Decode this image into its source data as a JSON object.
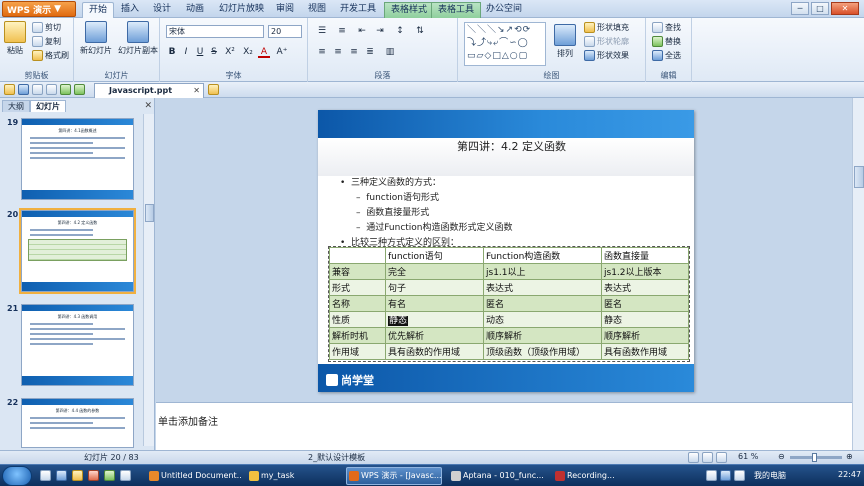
{
  "app": {
    "name": "WPS 演示",
    "dropdown": "▼"
  },
  "menu": {
    "tabs": [
      "开始",
      "插入",
      "设计",
      "动画",
      "幻灯片放映",
      "审阅",
      "视图",
      "开发工具"
    ],
    "tool_tabs": [
      "表格样式",
      "表格工具"
    ],
    "extra_tab": "办公空间",
    "active": "开始"
  },
  "ribbon": {
    "clipboard": {
      "paste": "粘贴",
      "cut": "剪切",
      "copy": "复制",
      "format_painter": "格式刷",
      "label": "剪贴板"
    },
    "slides": {
      "new_slide": "新幻灯片",
      "slide_copy": "幻灯片副本",
      "label": "幻灯片"
    },
    "font": {
      "family": "宋体",
      "size": "20",
      "bold": "B",
      "italic": "I",
      "underline": "U",
      "strike": "S",
      "superscript": "X²",
      "subscript": "X₂",
      "label": "字体"
    },
    "paragraph": {
      "label": "段落"
    },
    "drawing": {
      "arrange": "排列",
      "shape_fill": "形状填充",
      "shape_outline": "形状轮廓",
      "shape_effect": "形状效果",
      "label": "绘图"
    },
    "editing": {
      "find": "查找",
      "replace": "替换",
      "select_all": "全选",
      "label": "编辑"
    }
  },
  "document_tab": {
    "name": "Javascript.ppt"
  },
  "left_pane": {
    "tabs": [
      "大纲",
      "幻灯片"
    ],
    "active_tab": "幻灯片",
    "thumbnails": [
      {
        "number": "19",
        "title": "第四讲：4.1函数概述",
        "selected": false,
        "has_table": false
      },
      {
        "number": "20",
        "title": "第四讲：4.2 定义函数",
        "selected": true,
        "has_table": true
      },
      {
        "number": "21",
        "title": "第四讲：4.3 函数调用",
        "selected": false,
        "has_table": false
      },
      {
        "number": "22",
        "title": "第四讲：4.4 函数的参数",
        "selected": false,
        "has_table": false
      }
    ]
  },
  "slide": {
    "title": "第四讲：4.2 定义函数",
    "bullets": [
      {
        "level": 1,
        "text": "三种定义函数的方式："
      },
      {
        "level": 2,
        "text": "function语句形式"
      },
      {
        "level": 2,
        "text": "函数直接量形式"
      },
      {
        "level": 2,
        "text": "通过Function构造函数形式定义函数"
      },
      {
        "level": 1,
        "text": "比较三种方式定义的区别："
      }
    ],
    "table": {
      "header": [
        "",
        "function语句",
        "Function构造函数",
        "函数直接量"
      ],
      "rows": [
        [
          "兼容",
          "完全",
          "js1.1以上",
          "js1.2以上版本"
        ],
        [
          "形式",
          "句子",
          "表达式",
          "表达式"
        ],
        [
          "名称",
          "有名",
          "匿名",
          "匿名"
        ],
        [
          "性质",
          "静态",
          "动态",
          "静态"
        ],
        [
          "解析时机",
          "优先解析",
          "顺序解析",
          "顺序解析"
        ],
        [
          "作用域",
          "具有函数的作用域",
          "顶级函数（顶级作用域）",
          "具有函数作用域"
        ]
      ]
    },
    "logo_text": "尚学堂"
  },
  "notes": {
    "placeholder": "单击添加备注"
  },
  "status": {
    "slide_pos": "幻灯片 20 / 83",
    "template": "2_默认设计模板",
    "zoom": "61 %"
  },
  "taskbar": {
    "items": [
      {
        "label": "Untitled Document...",
        "active": false,
        "color": "#e8892a"
      },
      {
        "label": "my_task",
        "active": false,
        "color": "#f0c040"
      },
      {
        "label": "WPS 演示 - [Javasc...",
        "active": true,
        "color": "#e26a1a"
      },
      {
        "label": "Aptana - 010_func...",
        "active": false,
        "color": "#d0d0d0"
      },
      {
        "label": "Recording...",
        "active": false,
        "color": "#c03030"
      }
    ],
    "tray_label": "我的电脑",
    "clock": "22:47"
  }
}
